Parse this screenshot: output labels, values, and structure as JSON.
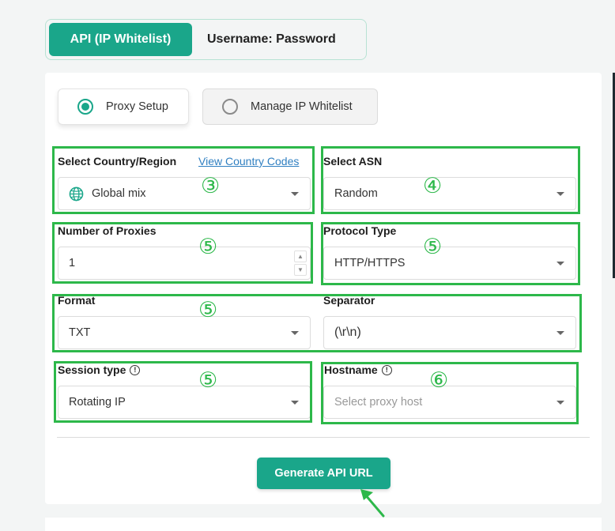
{
  "auth_tabs": {
    "active": "API (IP Whitelist)",
    "inactive": "Username: Password"
  },
  "mode": {
    "proxy_setup": "Proxy Setup",
    "manage_whitelist": "Manage IP Whitelist"
  },
  "fields": {
    "country": {
      "label": "Select Country/Region",
      "link": "View Country Codes",
      "value": "Global mix",
      "icon": "globe-icon"
    },
    "asn": {
      "label": "Select ASN",
      "value": "Random"
    },
    "num_proxies": {
      "label": "Number of Proxies",
      "value": "1"
    },
    "protocol": {
      "label": "Protocol Type",
      "value": "HTTP/HTTPS"
    },
    "format": {
      "label": "Format",
      "value": "TXT"
    },
    "separator": {
      "label": "Separator",
      "value": "(\\r\\n)"
    },
    "session": {
      "label": "Session type",
      "value": "Rotating IP"
    },
    "hostname": {
      "label": "Hostname",
      "placeholder": "Select proxy host"
    }
  },
  "annotations": {
    "country": "③",
    "asn": "④",
    "num_proxies": "⑤",
    "protocol": "⑤",
    "format_row": "⑤",
    "session": "⑤",
    "hostname": "⑥"
  },
  "generate_button": "Generate API URL",
  "colors": {
    "accent": "#1aa68a",
    "highlight": "#2db84a",
    "link": "#2f7fc1"
  }
}
